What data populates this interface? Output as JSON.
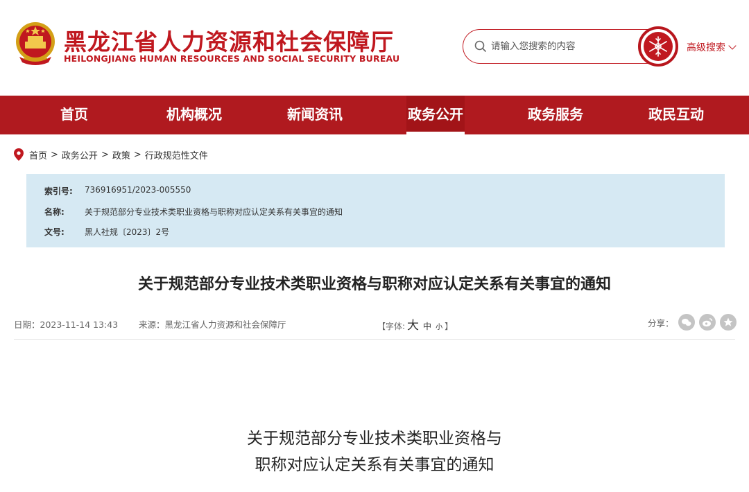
{
  "header": {
    "title_cn": "黑龙江省人力资源和社会保障厅",
    "title_en": "HEILONGJIANG HUMAN RESOURCES AND SOCIAL SECURITY BUREAU",
    "search_placeholder": "请输入您搜索的内容",
    "advanced_search": "高级搜索",
    "brand_color": "#c0181f"
  },
  "nav": {
    "items": [
      {
        "label": "首页"
      },
      {
        "label": "机构概况"
      },
      {
        "label": "新闻资讯"
      },
      {
        "label": "政务公开",
        "active": true
      },
      {
        "label": "政务服务"
      },
      {
        "label": "政民互动"
      }
    ],
    "bg_color": "#b01a1f"
  },
  "breadcrumb": {
    "items": [
      "首页",
      "政务公开",
      "政策",
      "行政规范性文件"
    ],
    "separator": ">"
  },
  "info": {
    "index_label": "索引号:",
    "index_value": "736916951/2023-005550",
    "name_label": "名称:",
    "name_value": "关于规范部分专业技术类职业资格与职称对应认定关系有关事宜的通知",
    "doc_label": "文号:",
    "doc_value": "黑人社规〔2023〕2号"
  },
  "article": {
    "title": "关于规范部分专业技术类职业资格与职称对应认定关系有关事宜的通知",
    "date": "日期：2023-11-14 13:43",
    "source": "来源：黑龙江省人力资源和社会保障厅",
    "font_prefix": "【字体:",
    "font_big": "大",
    "font_mid": "中",
    "font_small": "小",
    "font_suffix": "】",
    "share_label": "分享：",
    "heading_line1": "关于规范部分专业技术类职业资格与",
    "heading_line2": "职称对应认定关系有关事宜的通知"
  }
}
